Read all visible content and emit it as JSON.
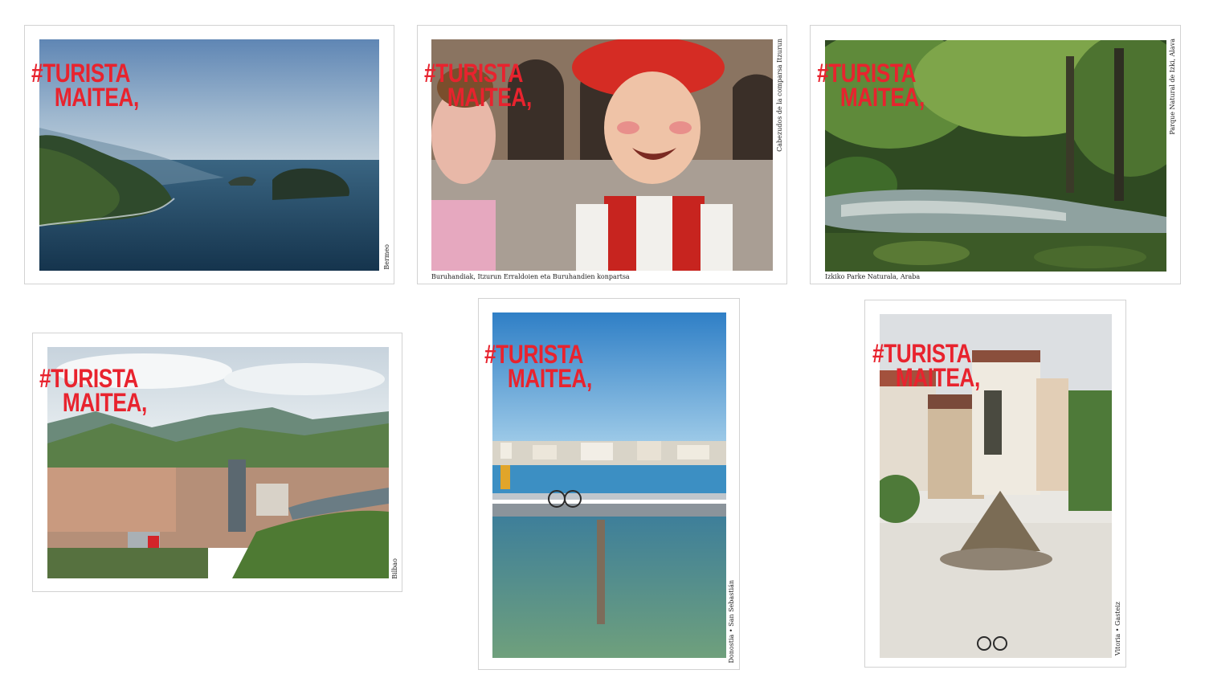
{
  "headline": {
    "line1": "#TURISTA",
    "line2": "MAITEA,"
  },
  "colors": {
    "headline": "#e8232e",
    "border": "#d2d2d2"
  },
  "cards": [
    {
      "caption": "Bermeo"
    },
    {
      "caption_side": "Cabezudos de la comparsa Itzurun",
      "caption_bottom": "Buruhandiak, Itzurun Erraldoien eta Buruhandien konpartsa"
    },
    {
      "caption_side": "Parque Natural de Izki, Álava",
      "caption_bottom": "Izkiko Parke Naturala, Araba"
    },
    {
      "caption": "Bilbao"
    },
    {
      "caption": "Donostia • San Sebastián"
    },
    {
      "caption": "Vitoria • Gasteiz"
    }
  ]
}
